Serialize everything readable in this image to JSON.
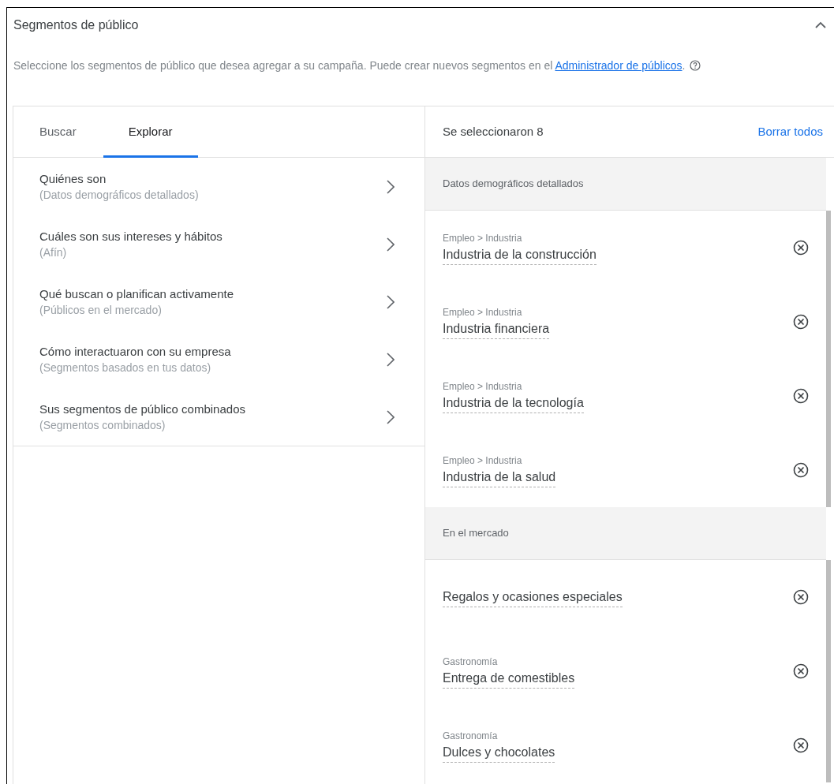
{
  "panel": {
    "title": "Segmentos de público",
    "expanded": true,
    "description": "Seleccione los segmentos de público que desea agregar a su campaña. Puede crear nuevos segmentos en el",
    "link": "Administrador de públicos",
    "link_suffix": "."
  },
  "tabs": [
    {
      "label": "Buscar",
      "selected": false
    },
    {
      "label": "Explorar",
      "selected": true
    }
  ],
  "categories": [
    {
      "title": "Quiénes son",
      "subtitle": "(Datos demográficos detallados)"
    },
    {
      "title": "Cuáles son sus intereses y hábitos",
      "subtitle": "(Afín)"
    },
    {
      "title": "Qué buscan o planifican activamente",
      "subtitle": "(Públicos en el mercado)"
    },
    {
      "title": "Cómo interactuaron con su empresa",
      "subtitle": "(Segmentos basados en tus datos)"
    },
    {
      "title": "Sus segmentos de público combinados",
      "subtitle": "(Segmentos combinados)"
    }
  ],
  "selection": {
    "count_label": "Se seleccionaron 8",
    "clear_all": "Borrar todos",
    "groups": [
      {
        "heading": "Datos demográficos detallados",
        "items": [
          {
            "path": "Empleo > Industria",
            "name": "Industria de la construcción"
          },
          {
            "path": "Empleo > Industria",
            "name": "Industria financiera"
          },
          {
            "path": "Empleo > Industria",
            "name": "Industria de la tecnología"
          },
          {
            "path": "Empleo > Industria",
            "name": "Industria de la salud"
          }
        ]
      },
      {
        "heading": "En el mercado",
        "items": [
          {
            "name": "Regalos y ocasiones especiales"
          },
          {
            "path": "Gastronomía",
            "name": "Entrega de comestibles"
          },
          {
            "path": "Gastronomía",
            "name": "Dulces y chocolates"
          }
        ]
      }
    ]
  }
}
